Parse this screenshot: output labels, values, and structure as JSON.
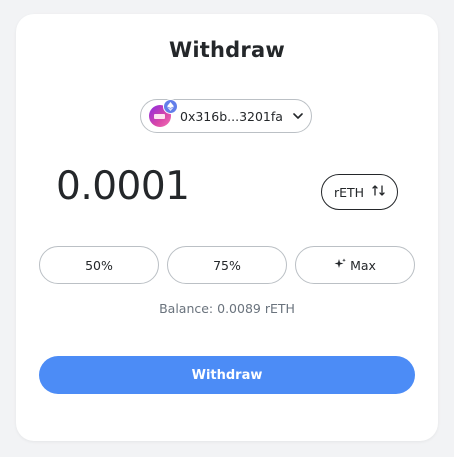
{
  "title": "Withdraw",
  "account": {
    "address": "0x316b...3201fa",
    "avatar_icon": "account-avatar-icon",
    "network_icon": "ethereum-icon"
  },
  "amount": {
    "value": "0.0001"
  },
  "token_toggle": {
    "label": "rETH",
    "icon": "swap-arrows-icon"
  },
  "percent_buttons": [
    {
      "label": "50%"
    },
    {
      "label": "75%"
    },
    {
      "label": "Max",
      "icon": "sparkle-icon"
    }
  ],
  "balance_text": "Balance: 0.0089 rETH",
  "withdraw_button": {
    "label": "Withdraw",
    "color": "#4c8cf6"
  }
}
